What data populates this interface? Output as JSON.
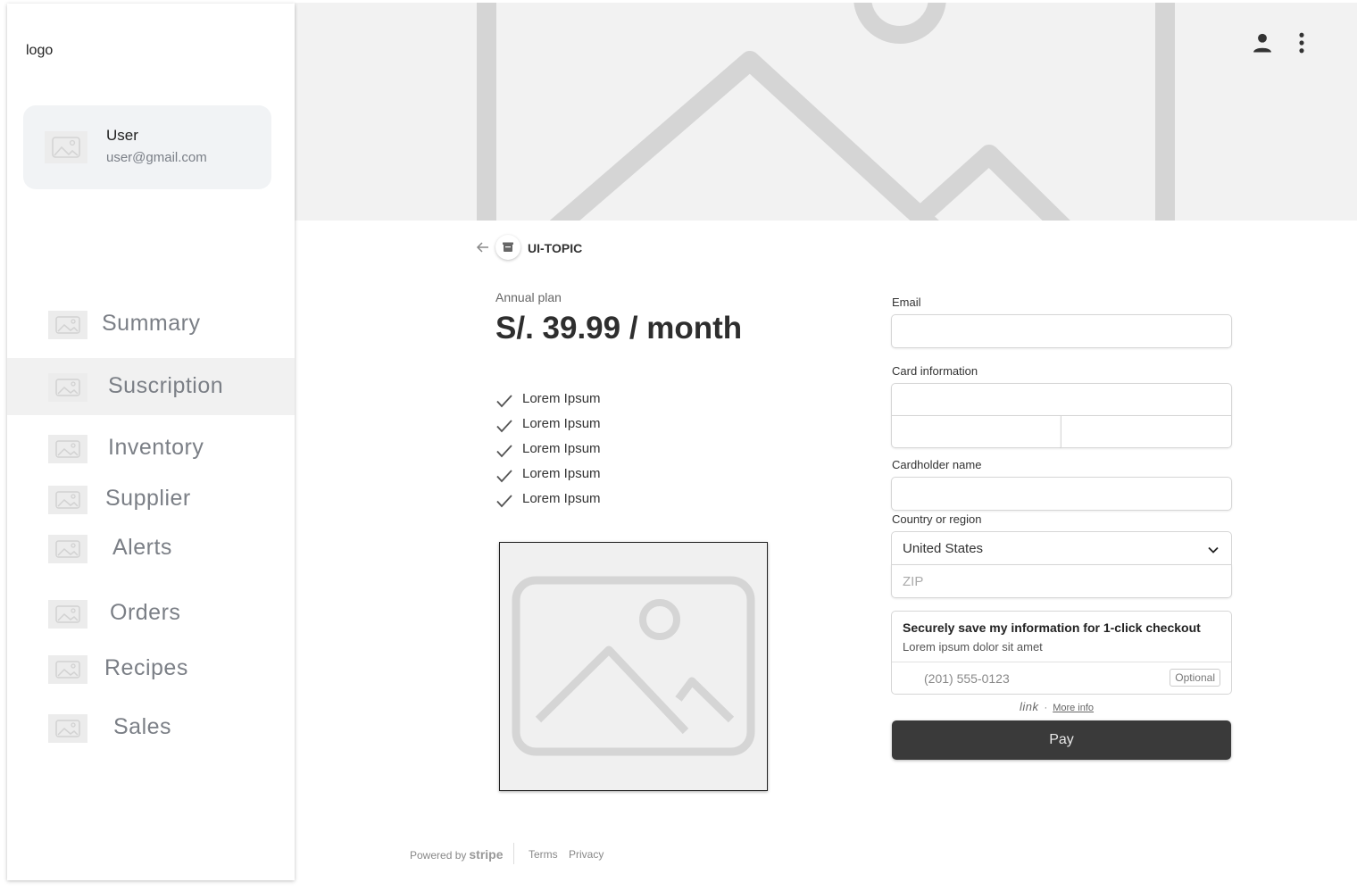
{
  "sidebar": {
    "logo": "logo",
    "user": {
      "name": "User",
      "email": "user@gmail.com"
    },
    "active_item": "Suscription",
    "items": [
      {
        "label": "Summary"
      },
      {
        "label": "Suscription"
      },
      {
        "label": "Inventory"
      },
      {
        "label": "Supplier"
      },
      {
        "label": "Alerts"
      },
      {
        "label": "Orders"
      },
      {
        "label": "Recipes"
      },
      {
        "label": "Sales"
      }
    ]
  },
  "header": {
    "banner_icon": "image-placeholder-icon",
    "actions": [
      {
        "icon": "person-icon"
      },
      {
        "icon": "more-vertical-icon"
      }
    ]
  },
  "checkout": {
    "store_name": "UI-TOPIC",
    "plan_label": "Annual plan",
    "price": "S/. 39.99 / month",
    "features": [
      "Lorem Ipsum",
      "Lorem Ipsum",
      "Lorem Ipsum",
      "Lorem Ipsum",
      "Lorem Ipsum"
    ],
    "footer": {
      "powered_by": "Powered by",
      "brand": "stripe",
      "terms": "Terms",
      "privacy": "Privacy"
    }
  },
  "form": {
    "email_label": "Email",
    "email_value": "",
    "card_label": "Card information",
    "card_number_value": "",
    "card_expiry_value": "",
    "card_cvc_value": "",
    "cardholder_label": "Cardholder name",
    "cardholder_value": "",
    "country_label": "Country or region",
    "country_value": "United States",
    "zip_placeholder": "ZIP",
    "save": {
      "title": "Securely save my information for 1-click checkout",
      "subtitle": "Lorem ipsum dolor sit amet",
      "phone_placeholder": "(201) 555-0123",
      "optional": "Optional"
    },
    "link": {
      "logo": "link",
      "separator": "·",
      "more_info": "More info"
    },
    "pay_label": "Pay"
  },
  "colors": {
    "accent": "#3a3a3a",
    "muted_text": "#7b7f86",
    "active_bg": "#f1f1f1"
  }
}
